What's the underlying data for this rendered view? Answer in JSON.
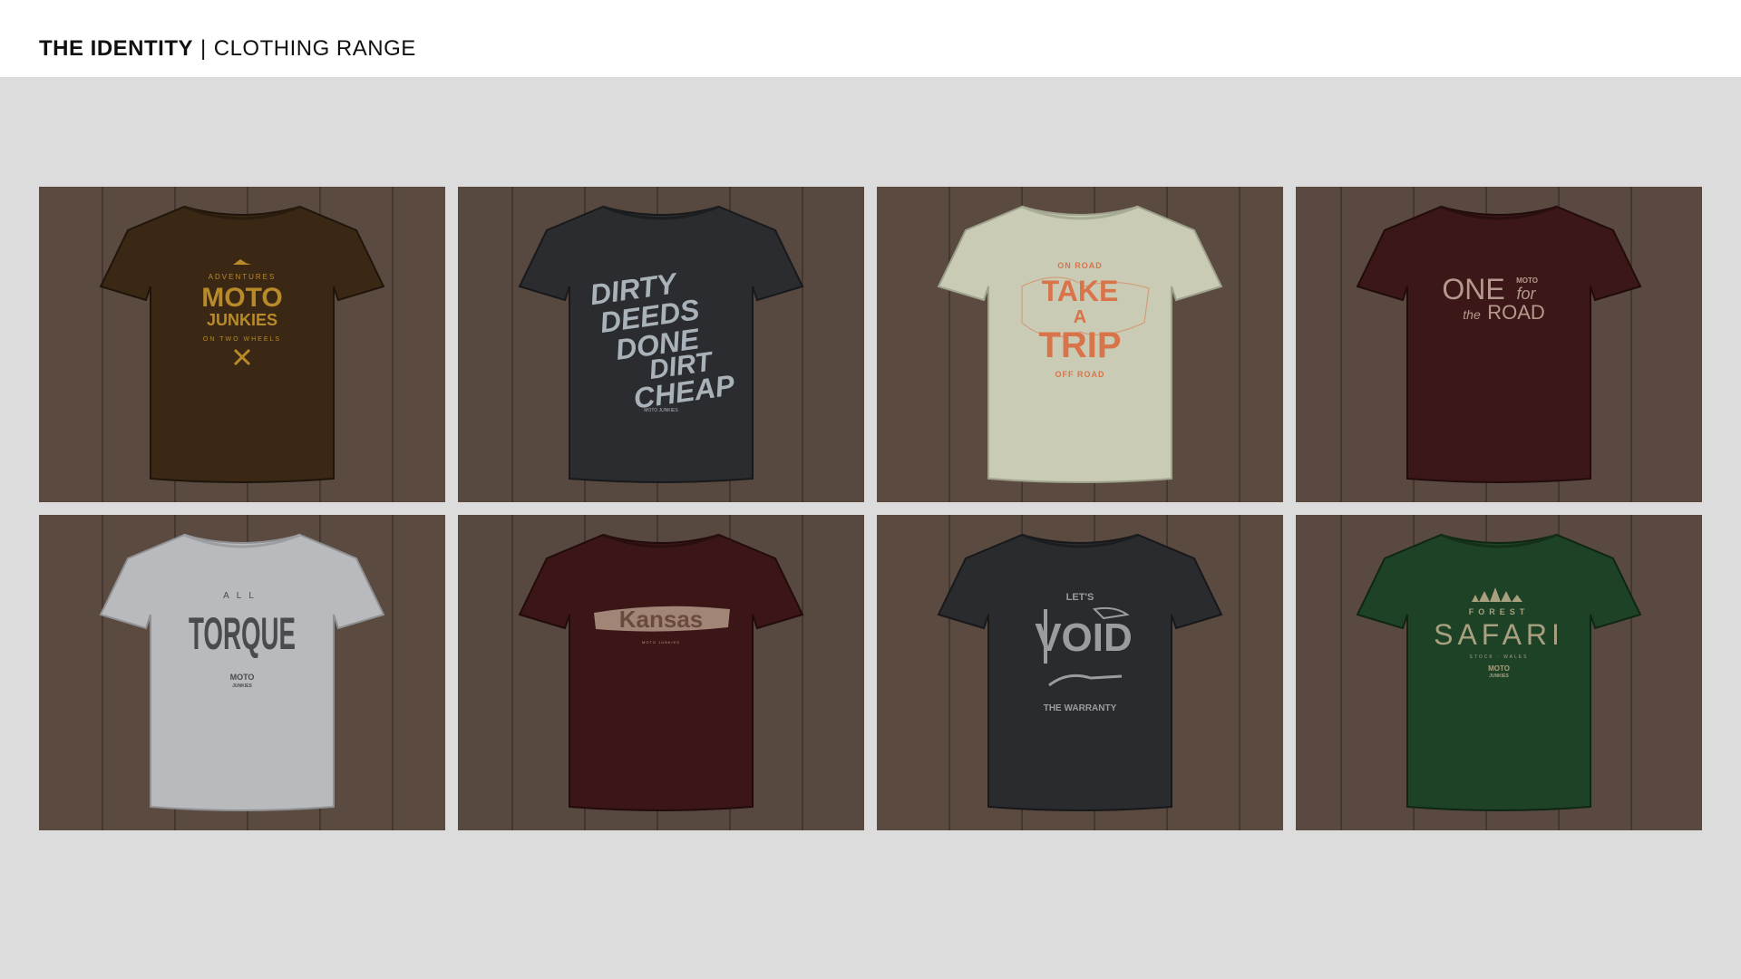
{
  "header": {
    "title": "THE IDENTITY",
    "subtitle": "CLOTHING RANGE"
  },
  "shirts": [
    {
      "color": "#3a2814",
      "ink": "#b98a2a",
      "lines": [
        "ADVENTURES",
        "MOTO",
        "JUNKIES",
        "ON TWO WHEELS"
      ]
    },
    {
      "color": "#2b2c2f",
      "ink": "#a8b2b8",
      "lines": [
        "DIRTY",
        "DEEDS",
        "DONE",
        "DIRT",
        "CHEAP",
        "MOTO JUNKIES"
      ]
    },
    {
      "color": "#c9cbb4",
      "ink": "#d9744a",
      "lines": [
        "ON ROAD",
        "TAKE",
        "A",
        "TRIP",
        "OFF ROAD"
      ]
    },
    {
      "color": "#3c1717",
      "ink": "#b49a8c",
      "lines": [
        "ONE",
        "MOTO",
        "for",
        "the",
        "ROAD"
      ]
    },
    {
      "color": "#b8babd",
      "ink": "#4a4b4d",
      "lines": [
        "ALL",
        "TORQUE",
        "MOTO",
        "JUNKIES"
      ]
    },
    {
      "color": "#3c1616",
      "ink": "#b39a8a",
      "lines": [
        "Kansas",
        "MOTO JUNKIES"
      ]
    },
    {
      "color": "#2a2b2e",
      "ink": "#9a9da0",
      "lines": [
        "LET'S",
        "VOID",
        "THE WARRANTY"
      ]
    },
    {
      "color": "#1d4226",
      "ink": "#a9a080",
      "lines": [
        "FOREST",
        "SAFARI",
        "STOCK · WALES",
        "MOTO",
        "JUNKIES"
      ]
    }
  ]
}
